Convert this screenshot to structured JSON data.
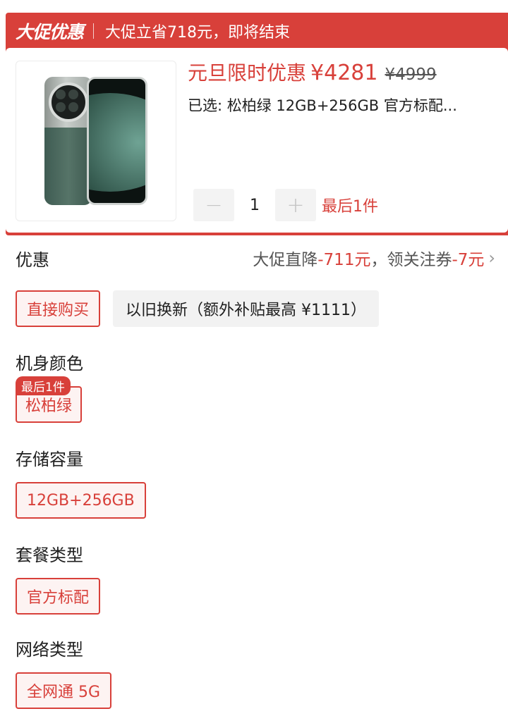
{
  "promo": {
    "tag": "大促优惠",
    "text": "大促立省718元，即将结束"
  },
  "product": {
    "price_label": "元旦限时优惠",
    "price_now": "¥4281",
    "price_old": "¥4999",
    "selected": "已选: 松柏绿 12GB+256GB 官方标配...",
    "quantity": "1",
    "qty_minus": "−",
    "qty_plus": "+",
    "stock_note": "最后1件",
    "image_icon": "phone-product-image"
  },
  "discount": {
    "title": "优惠",
    "part1": "大促直降",
    "amount1": "-711元",
    "comma": "，",
    "part2": "领关注券",
    "amount2": "-7元",
    "chevron": "›"
  },
  "buy_options": {
    "direct": "直接购买",
    "trade_in": "以旧换新（额外补贴最高 ¥1111）"
  },
  "specs": {
    "color": {
      "title": "机身颜色",
      "value": "松柏绿",
      "badge": "最后1件"
    },
    "storage": {
      "title": "存储容量",
      "value": "12GB+256GB"
    },
    "package": {
      "title": "套餐类型",
      "value": "官方标配"
    },
    "network": {
      "title": "网络类型",
      "value": "全网通 5G"
    }
  },
  "colors": {
    "accent": "#d8403a",
    "chip_bg": "#fdf3f2",
    "grey_chip": "#f2f2f2"
  }
}
